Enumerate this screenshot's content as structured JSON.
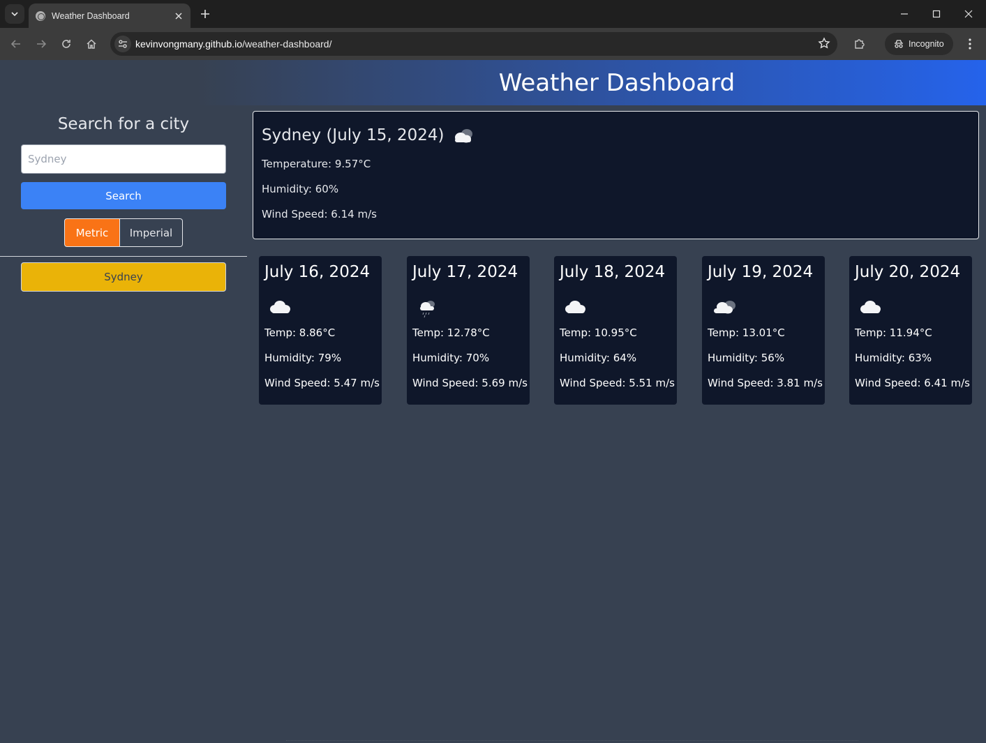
{
  "browser": {
    "tab_title": "Weather Dashboard",
    "url_host": "kevinvongmany.github.io",
    "url_path": "/weather-dashboard/",
    "incognito_label": "Incognito"
  },
  "header": {
    "title": "Weather Dashboard"
  },
  "sidebar": {
    "search_title": "Search for a city",
    "search_placeholder": "Sydney",
    "search_button": "Search",
    "units": {
      "metric": "Metric",
      "imperial": "Imperial",
      "selected": "Metric"
    },
    "history": [
      "Sydney"
    ]
  },
  "current": {
    "title": "Sydney (July 15, 2024)",
    "icon": "broken-clouds-icon",
    "temperature": "Temperature: 9.57°C",
    "humidity": "Humidity: 60%",
    "wind": "Wind Speed: 6.14 m/s"
  },
  "forecast": [
    {
      "date": "July 16, 2024",
      "icon": "cloud-icon",
      "temp": "Temp: 8.86°C",
      "humidity": "Humidity: 79%",
      "wind": "Wind Speed: 5.47 m/s"
    },
    {
      "date": "July 17, 2024",
      "icon": "light-rain-icon",
      "temp": "Temp: 12.78°C",
      "humidity": "Humidity: 70%",
      "wind": "Wind Speed: 5.69 m/s"
    },
    {
      "date": "July 18, 2024",
      "icon": "cloud-icon",
      "temp": "Temp: 10.95°C",
      "humidity": "Humidity: 64%",
      "wind": "Wind Speed: 5.51 m/s"
    },
    {
      "date": "July 19, 2024",
      "icon": "broken-clouds-icon",
      "temp": "Temp: 13.01°C",
      "humidity": "Humidity: 56%",
      "wind": "Wind Speed: 3.81 m/s"
    },
    {
      "date": "July 20, 2024",
      "icon": "cloud-icon",
      "temp": "Temp: 11.94°C",
      "humidity": "Humidity: 63%",
      "wind": "Wind Speed: 6.41 m/s"
    }
  ],
  "colors": {
    "background": "#374151",
    "header_gradient_end": "#2563eb",
    "card_background": "#0f172a",
    "search_button": "#3b82f6",
    "metric_active": "#f97316",
    "history_button": "#eab308"
  }
}
